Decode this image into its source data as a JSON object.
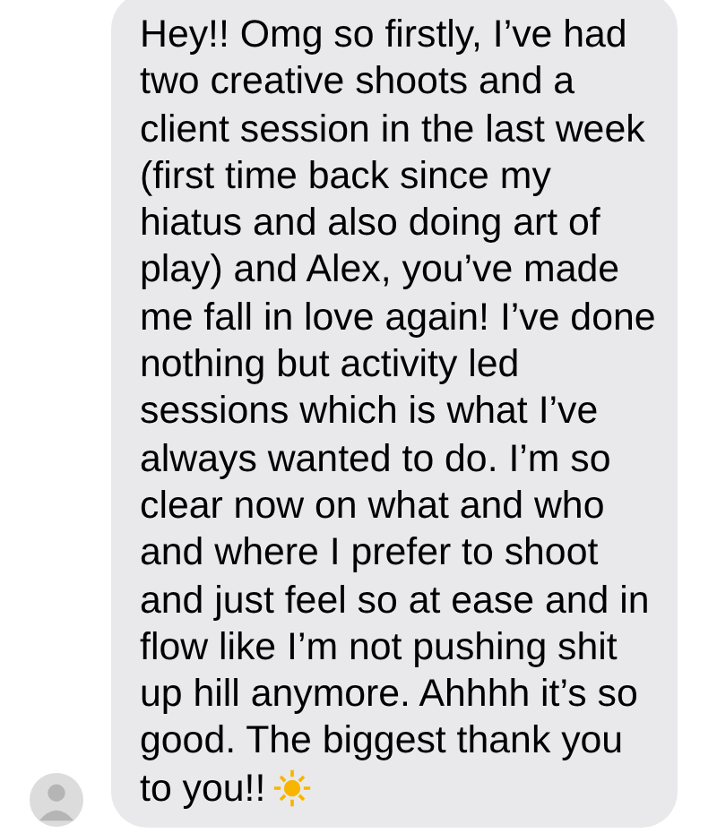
{
  "message": {
    "text": "Hey!! Omg so firstly, I’ve had\ntwo creative shoots and a\nclient session in the last week\n(first time back since my\nhiatus and also doing art of\nplay) and Alex, you’ve made\nme fall in love again! I’ve done\nnothing but activity led\nsessions which is what I’ve\nalways wanted to do. I’m so\nclear now on what and who\nand where I prefer to shoot\nand just feel so at ease and in\nflow like I’m not pushing shit\nup hill anymore. Ahhhh it’s so\ngood. The biggest thank you\nto you!!"
  }
}
